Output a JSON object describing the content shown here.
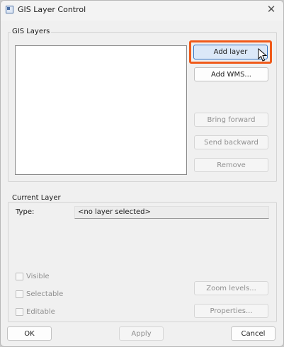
{
  "window": {
    "title": "GIS Layer Control",
    "close_glyph": "✕"
  },
  "gis_layers": {
    "group_label": "GIS Layers",
    "items": [],
    "buttons": {
      "add_layer": "Add layer",
      "add_wms": "Add WMS...",
      "bring_forward": "Bring forward",
      "send_backward": "Send backward",
      "remove": "Remove"
    }
  },
  "current_layer": {
    "group_label": "Current Layer",
    "type_label": "Type:",
    "type_value": "<no layer selected>",
    "checkboxes": {
      "visible": "Visible",
      "selectable": "Selectable",
      "editable": "Editable"
    },
    "buttons": {
      "zoom_levels": "Zoom levels...",
      "properties": "Properties..."
    }
  },
  "footer": {
    "ok": "OK",
    "apply": "Apply",
    "cancel": "Cancel"
  },
  "colors": {
    "highlight": "#f05a1a",
    "accent": "#2f72c4"
  }
}
